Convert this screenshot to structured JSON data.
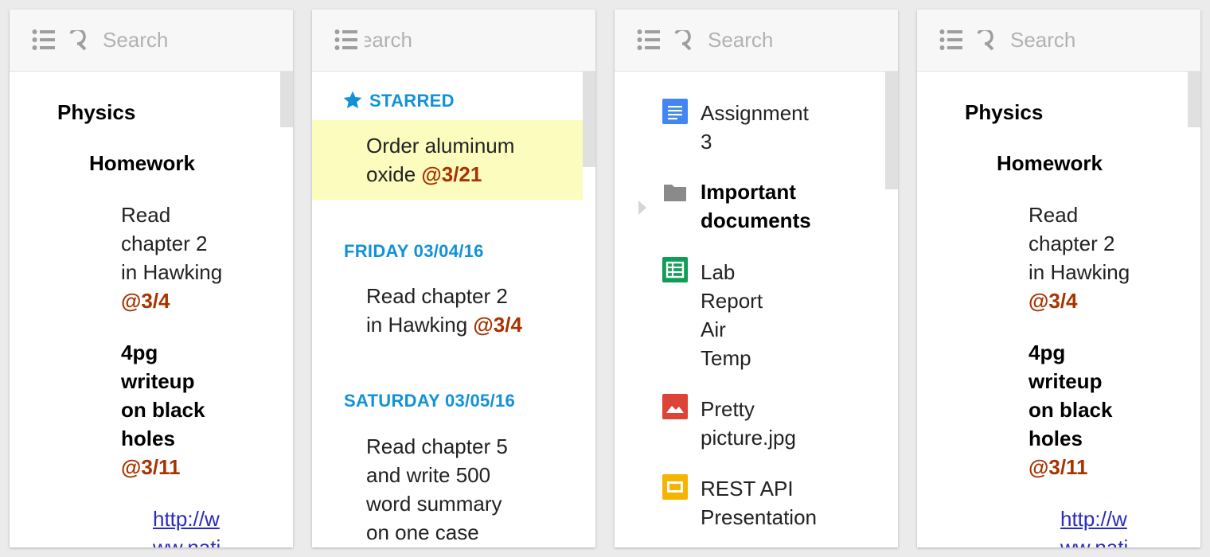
{
  "search": {
    "placeholder": "Search",
    "placeholder_partial": "Search"
  },
  "outline_panel": {
    "heading": "Physics",
    "subheading": "Homework",
    "task1": {
      "lines": [
        "Read",
        "chapter 2",
        "in Hawking"
      ],
      "due": "@3/4"
    },
    "task2": {
      "lines": [
        "4pg",
        "writeup",
        "on black",
        "holes"
      ],
      "due": "@3/11"
    },
    "link": {
      "lines": [
        "http://w",
        "ww.nati"
      ]
    }
  },
  "agenda_panel": {
    "starred_label": "STARRED",
    "starred_task": {
      "lines": [
        "Order aluminum",
        "oxide"
      ],
      "due": "@3/21"
    },
    "section1_label": "FRIDAY 03/04/16",
    "section1_task": {
      "lines": [
        "Read chapter 2",
        "in Hawking"
      ],
      "due": "@3/4"
    },
    "section2_label": "SATURDAY 03/05/16",
    "section2_task": {
      "lines": [
        "Read chapter 5",
        "and write 500",
        "word summary",
        "on one case"
      ]
    }
  },
  "files_panel": {
    "files": [
      {
        "icon": "docs-icon",
        "lines": [
          "Assignment",
          "3"
        ]
      },
      {
        "icon": "folder-icon",
        "lines": [
          "Important",
          "documents"
        ]
      },
      {
        "icon": "sheets-icon",
        "lines": [
          "Lab",
          "Report",
          "Air",
          "Temp"
        ]
      },
      {
        "icon": "image-icon",
        "lines": [
          "Pretty",
          "picture.jpg"
        ]
      },
      {
        "icon": "slides-icon",
        "lines": [
          "REST API",
          "Presentation"
        ]
      }
    ]
  },
  "colors": {
    "due": "#a83300",
    "section_header": "#1192d8",
    "highlight": "#fcfcbe",
    "link": "#2a2abf",
    "docs": "#4285f4",
    "sheets": "#0f9d58",
    "image": "#db4437",
    "slides": "#f4b400",
    "folder": "#8a8a8a"
  }
}
